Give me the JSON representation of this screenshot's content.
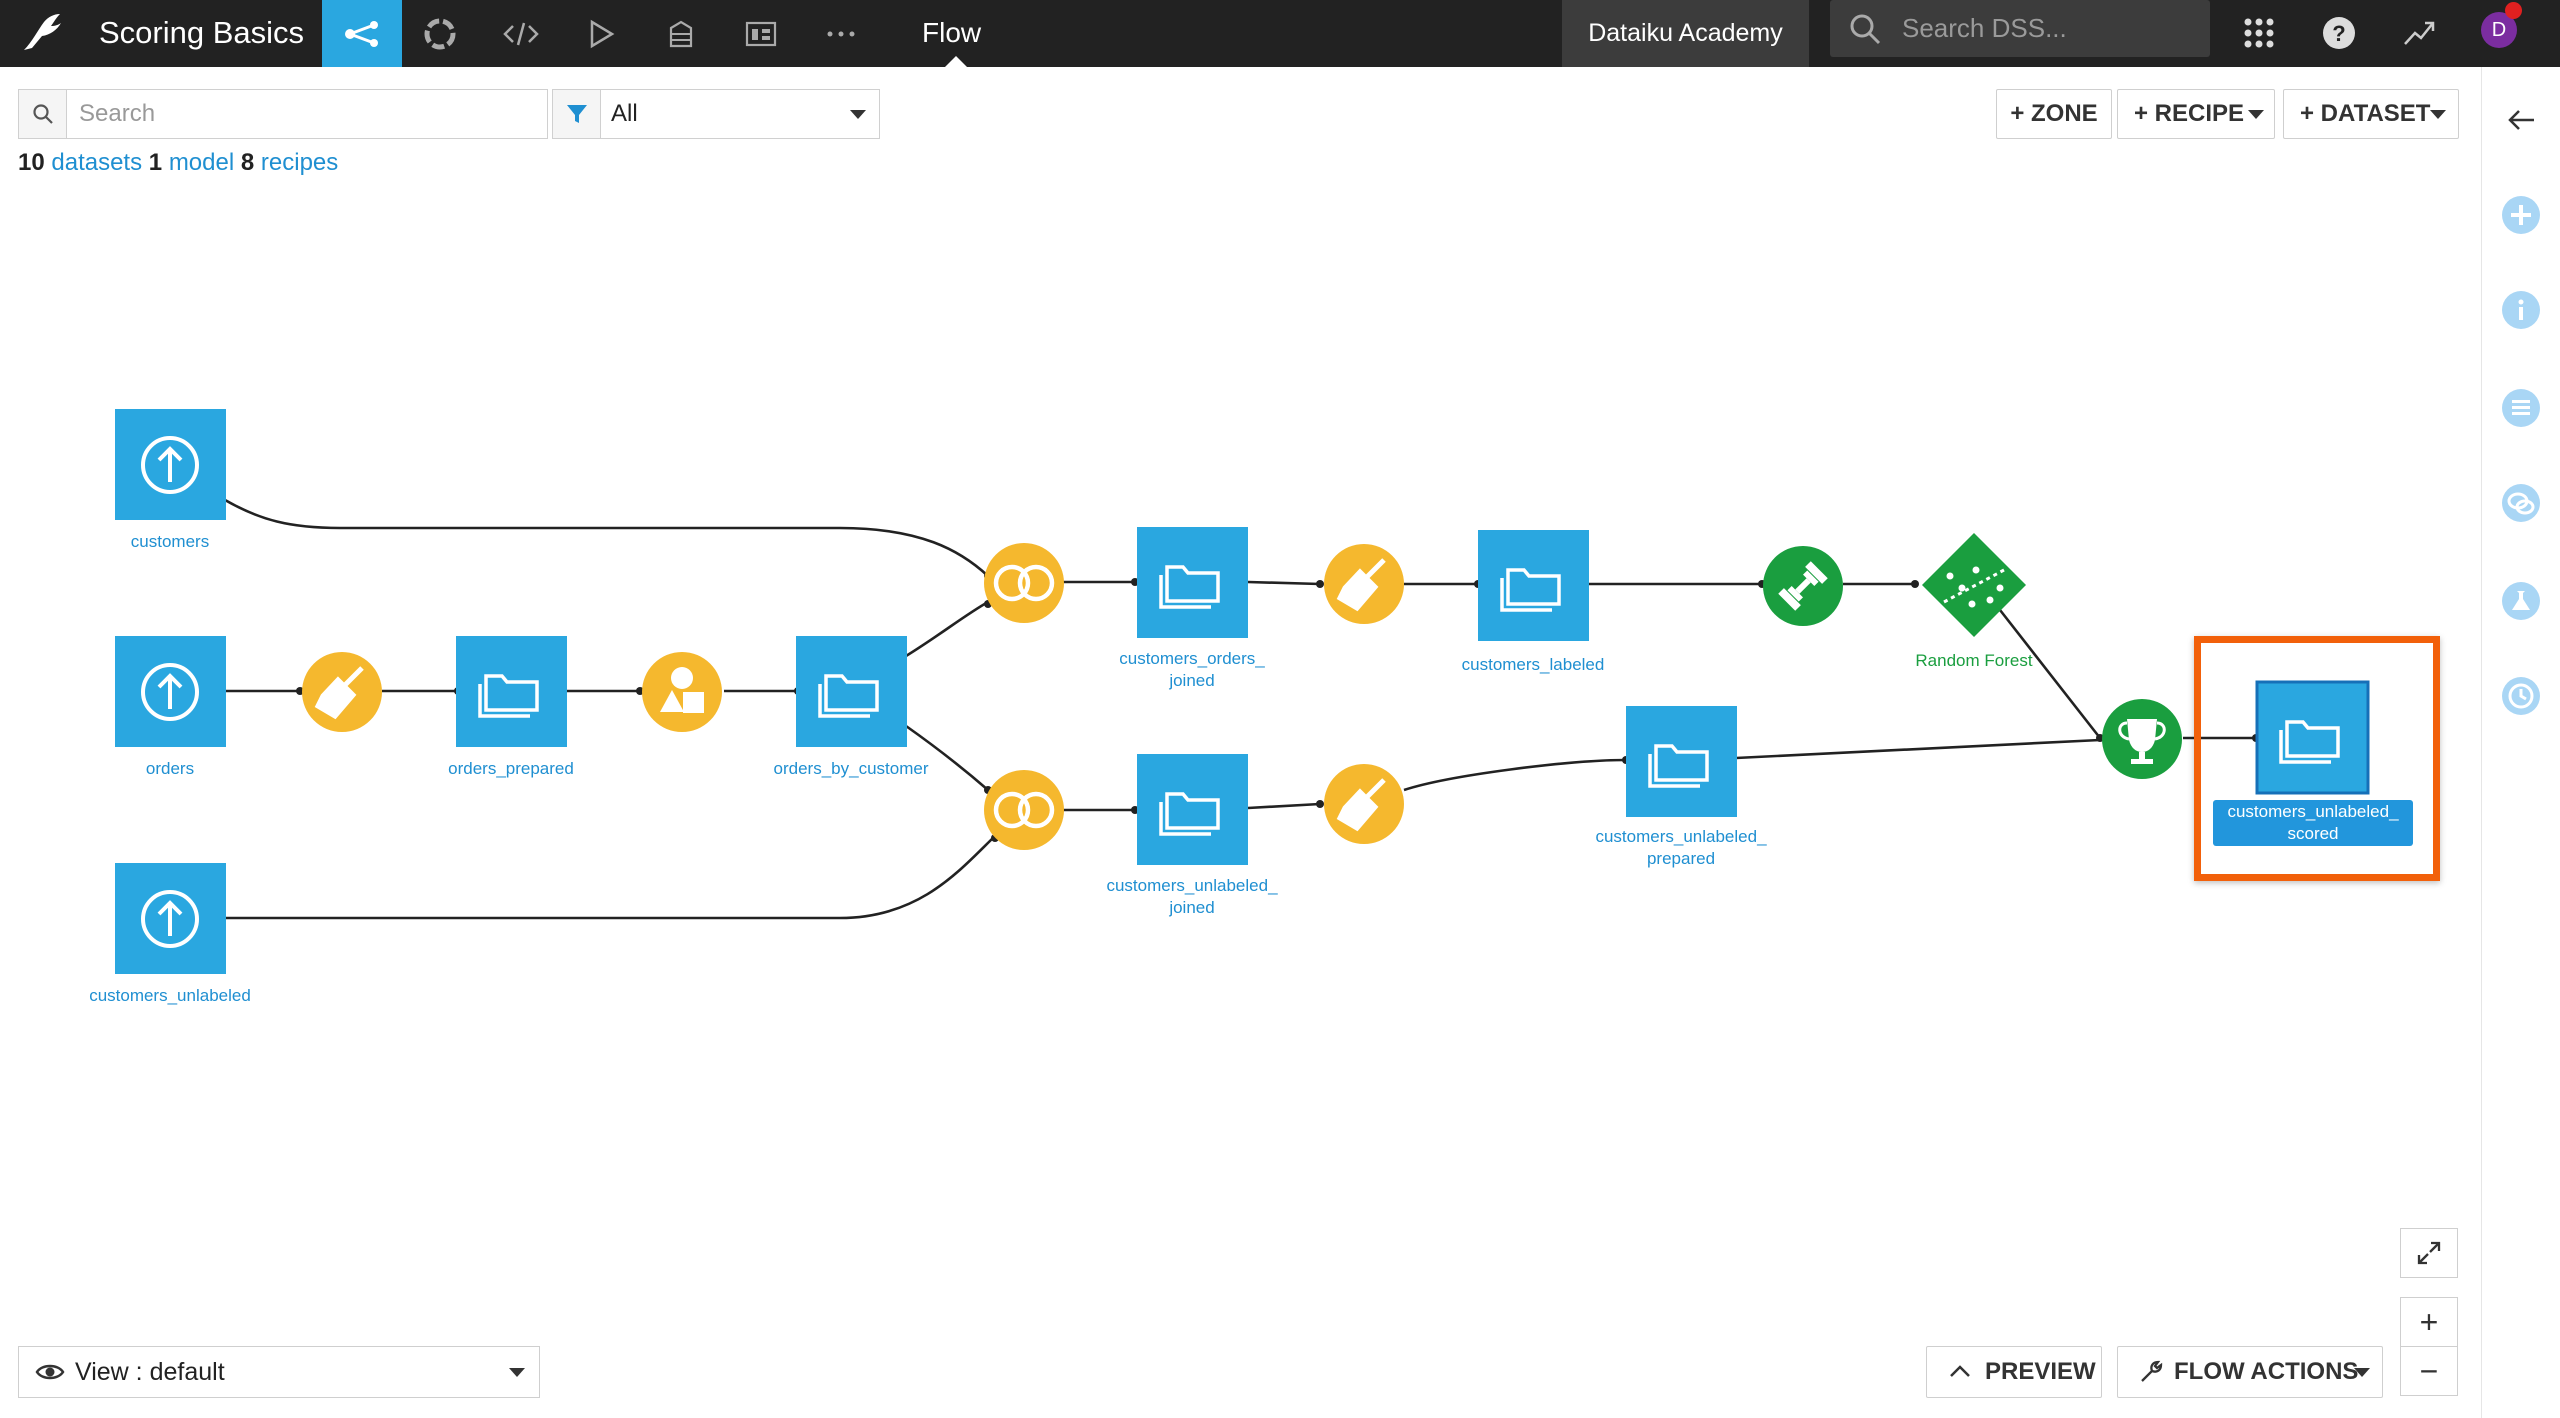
{
  "topbar": {
    "project_name": "Scoring Basics",
    "current_view": "Flow",
    "instance_name": "Dataiku Academy",
    "search_placeholder": "Search DSS...",
    "avatar_initial": "D",
    "nav_icons": [
      "flow-icon",
      "lifecycle-icon",
      "code-icon",
      "run-icon",
      "stack-icon",
      "dashboard-icon",
      "more-icon"
    ],
    "accent_color": "#2aa7e0"
  },
  "toolbar": {
    "search_placeholder": "Search",
    "filter_value": "All",
    "zone_button": "+ ZONE",
    "recipe_button": "+ RECIPE",
    "dataset_button": "+ DATASET",
    "summary": {
      "datasets_count": "10",
      "datasets_label": "datasets",
      "models_count": "1",
      "models_label": "model",
      "recipes_count": "8",
      "recipes_label": "recipes"
    }
  },
  "flow": {
    "datasets": {
      "customers": "customers",
      "orders": "orders",
      "customers_unlabeled": "customers_unlabeled",
      "orders_prepared": "orders_prepared",
      "orders_by_customer": "orders_by_customer",
      "customers_orders_joined": "customers_orders_\njoined",
      "customers_unlabeled_joined": "customers_unlabeled_\njoined",
      "customers_labeled": "customers_labeled",
      "customers_unlabeled_prepared": "customers_unlabeled_\nprepared",
      "customers_unlabeled_scored": "customers_unlabeled_\nscored"
    },
    "model_label": "Random Forest",
    "colors": {
      "dataset": "#2aa7e0",
      "visual_recipe": "#f5b82e",
      "ml_recipe": "#1a9e3f",
      "highlight": "#f2600a"
    }
  },
  "bottom": {
    "view_label": "View : default",
    "preview_button": "PREVIEW",
    "flow_actions_button": "FLOW ACTIONS",
    "zoom_in": "+",
    "zoom_out": "−"
  },
  "rightbar": {
    "icons": [
      "back-arrow-icon",
      "add-icon",
      "info-icon",
      "list-icon",
      "discussion-icon",
      "lab-icon",
      "timeline-icon"
    ]
  }
}
